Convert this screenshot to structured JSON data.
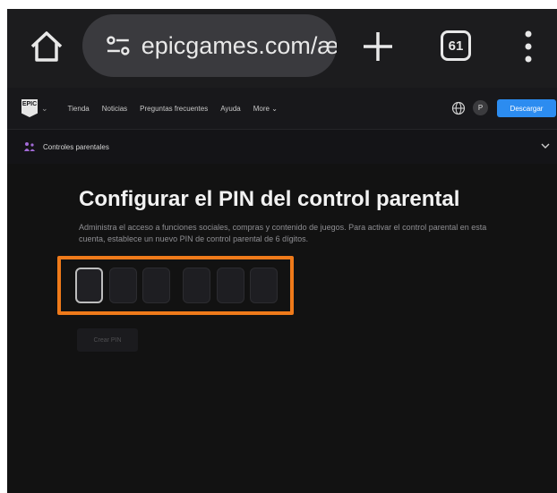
{
  "browser": {
    "url": "epicgames.com/æ",
    "tab_count": "61"
  },
  "nav": {
    "logo_text": "EPIC",
    "links": [
      "Tienda",
      "Noticias",
      "Preguntas frecuentes",
      "Ayuda",
      "More ⌄"
    ],
    "avatar_initial": "P",
    "download_label": "Descargar",
    "accent_color": "#2c8cf0"
  },
  "subnav": {
    "label": "Controles parentales"
  },
  "main": {
    "title": "Configurar el PIN del control parental",
    "description": "Administra el acceso a funciones sociales, compras y contenido de juegos. Para activar el control parental en esta cuenta, establece un nuevo PIN de control parental de 6 dígitos.",
    "pin_digits": [
      "",
      "",
      "",
      "",
      "",
      ""
    ],
    "create_button_label": "Crear PIN",
    "highlight_color": "#ef7a1a"
  }
}
